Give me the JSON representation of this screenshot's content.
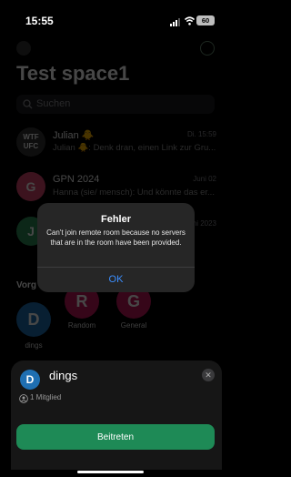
{
  "status_bar": {
    "time": "15:55",
    "battery": "60"
  },
  "header": {
    "title": "Test space1"
  },
  "search": {
    "placeholder": "Suchen"
  },
  "chats": [
    {
      "title": "Julian 🐥",
      "subtitle": "Julian 🐥: Denk dran, einen Link zur Gru...",
      "time": "Di. 15:59",
      "avatar": "WTF UFC"
    },
    {
      "title": "GPN 2024",
      "subtitle": "Hanna (sie/ mensch): Und könnte das er...",
      "time": "Juni 02",
      "avatar": "G"
    },
    {
      "title": "",
      "subtitle": "",
      "time": "Juni 2023",
      "avatar": "J"
    }
  ],
  "suggested": {
    "label": "Vorgeschlagen",
    "visible_label": "Vorg",
    "items": [
      {
        "name": "dings",
        "initial": "D",
        "color": "#1f6fb2"
      },
      {
        "name": "Random",
        "initial": "R",
        "color": "#c2185b"
      },
      {
        "name": "General",
        "initial": "G",
        "color": "#c2185b"
      }
    ]
  },
  "sheet": {
    "title": "dings",
    "initial": "D",
    "members": "1 Mitglied",
    "join_label": "Beitreten",
    "close_symbol": "✕"
  },
  "alert": {
    "title": "Fehler",
    "message": "Can't join remote room because no servers that are in the room have been provided.",
    "ok_label": "OK"
  },
  "colors": {
    "accent": "#1e8a56",
    "link": "#3b8eff",
    "dings": "#1f6fb2",
    "random": "#c2185b"
  }
}
